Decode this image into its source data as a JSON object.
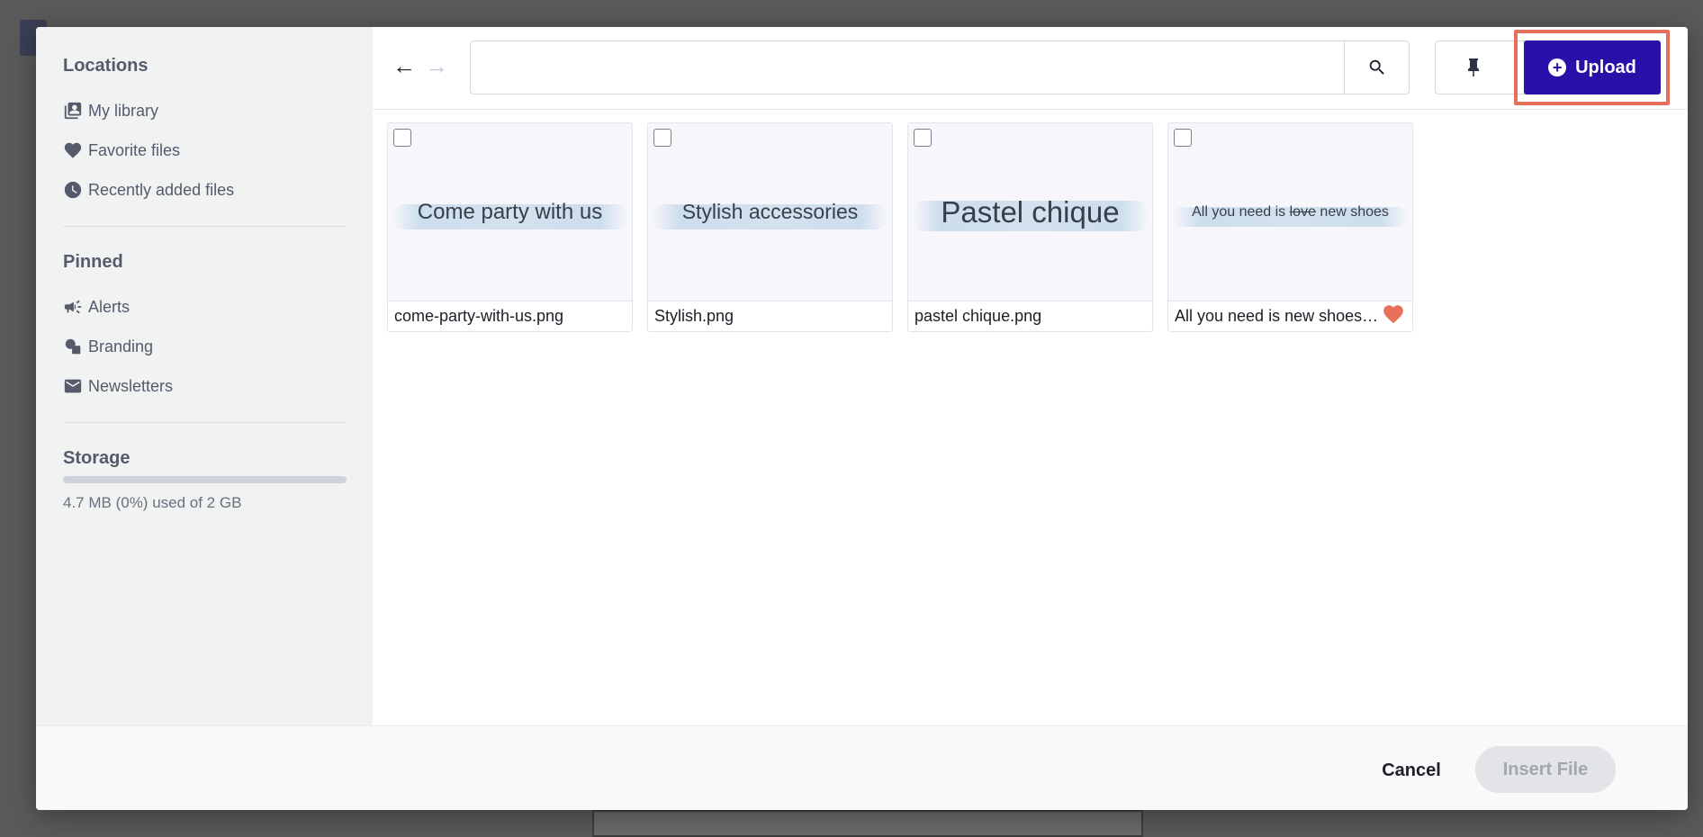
{
  "sidebar": {
    "locations_heading": "Locations",
    "locations": [
      {
        "label": "My library",
        "icon": "library-icon"
      },
      {
        "label": "Favorite files",
        "icon": "heart-icon"
      },
      {
        "label": "Recently added files",
        "icon": "clock-icon"
      }
    ],
    "pinned_heading": "Pinned",
    "pinned": [
      {
        "label": "Alerts",
        "icon": "megaphone-icon"
      },
      {
        "label": "Branding",
        "icon": "shapes-icon"
      },
      {
        "label": "Newsletters",
        "icon": "mail-icon"
      }
    ],
    "storage_heading": "Storage",
    "storage_used_fraction": 0.0,
    "storage_text": "4.7 MB (0%) used of 2 GB"
  },
  "toolbar": {
    "back_arrow": "←",
    "forward_arrow": "→",
    "search_value": "",
    "search_placeholder": "",
    "upload_label": "Upload",
    "upload_icon": "plus-circle-icon"
  },
  "files": [
    {
      "thumb_text": "Come party with us",
      "name": "come-party-with-us.png",
      "favorite": false
    },
    {
      "thumb_text": "Stylish accessories",
      "name": "Stylish.png",
      "favorite": false
    },
    {
      "thumb_text": "Pastel chique",
      "name": "pastel chique.png",
      "favorite": false
    },
    {
      "thumb_text_pre": "All you need is ",
      "thumb_text_strike": "love",
      "thumb_text_post": " new shoes",
      "name": "All you need is new shoes.png",
      "favorite": true
    }
  ],
  "footer": {
    "cancel_label": "Cancel",
    "insert_label": "Insert File"
  },
  "colors": {
    "accent": "#2a0fa8",
    "highlight": "#e8705a"
  }
}
